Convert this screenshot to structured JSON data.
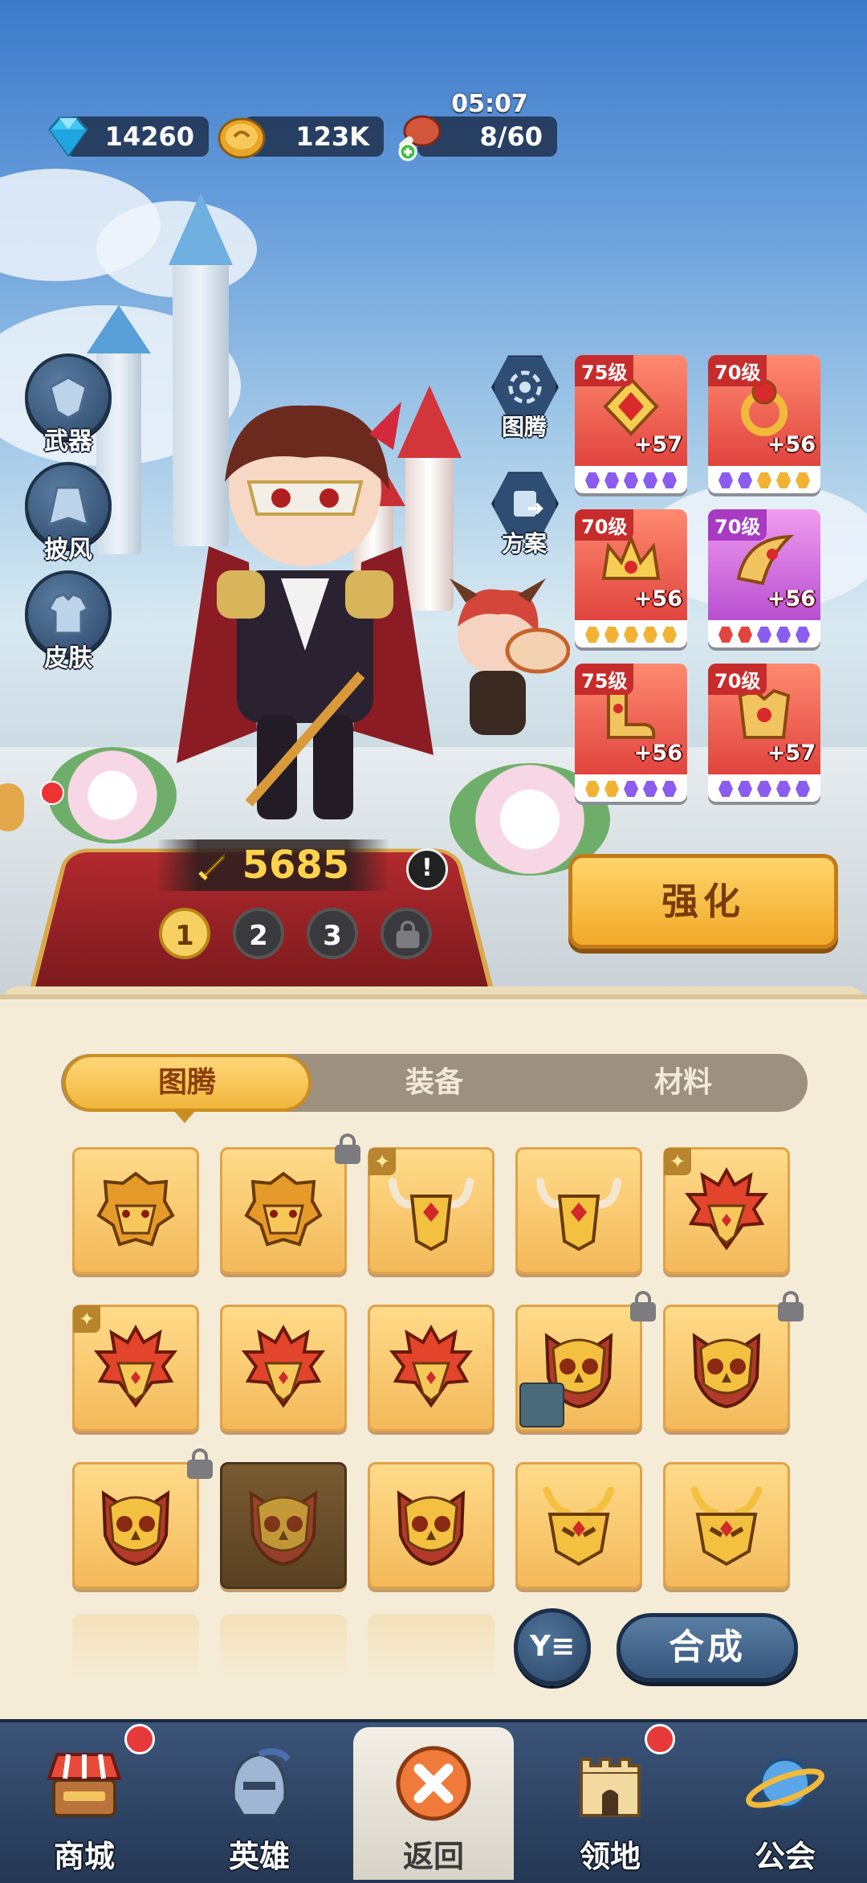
{
  "currency": {
    "timer": "05:07",
    "gems": "14260",
    "gold": "123K",
    "stamina": "8/60"
  },
  "side_menu": [
    {
      "label": "武器",
      "icon": "weapon-icon"
    },
    {
      "label": "披风",
      "icon": "cape-icon"
    },
    {
      "label": "皮肤",
      "icon": "skin-icon"
    }
  ],
  "hex_menu": [
    {
      "label": "图腾",
      "icon": "totem-icon"
    },
    {
      "label": "方案",
      "icon": "preset-icon"
    }
  ],
  "equipment": [
    {
      "level": "75级",
      "plus": "+57",
      "rarity": "red",
      "dots": [
        "#8a5cf0",
        "#8a5cf0",
        "#8a5cf0",
        "#8a5cf0",
        "#8a5cf0"
      ]
    },
    {
      "level": "70级",
      "plus": "+56",
      "rarity": "red",
      "dots": [
        "#8a5cf0",
        "#8a5cf0",
        "#f2b233",
        "#f2b233",
        "#f2b233"
      ]
    },
    {
      "level": "70级",
      "plus": "+56",
      "rarity": "red",
      "dots": [
        "#f2b233",
        "#f2b233",
        "#f2b233",
        "#f2b233",
        "#f2b233"
      ]
    },
    {
      "level": "70级",
      "plus": "+56",
      "rarity": "purple",
      "dots": [
        "#e2443e",
        "#e2443e",
        "#8a5cf0",
        "#8a5cf0",
        "#8a5cf0"
      ]
    },
    {
      "level": "75级",
      "plus": "+56",
      "rarity": "red",
      "dots": [
        "#f2b233",
        "#f2b233",
        "#8a5cf0",
        "#8a5cf0",
        "#8a5cf0"
      ]
    },
    {
      "level": "70级",
      "plus": "+57",
      "rarity": "red",
      "dots": [
        "#8a5cf0",
        "#8a5cf0",
        "#8a5cf0",
        "#8a5cf0",
        "#8a5cf0"
      ]
    }
  ],
  "power": "5685",
  "warning": "!",
  "loadout_slots": [
    "1",
    "2",
    "3"
  ],
  "enhance_label": "强化",
  "tabs": [
    "图腾",
    "装备",
    "材料"
  ],
  "totem_grid": [
    [
      {
        "type": "lion",
        "lock": false,
        "star": false
      },
      {
        "type": "lion",
        "lock": true,
        "star": false
      },
      {
        "type": "bull",
        "lock": false,
        "star": true
      },
      {
        "type": "bull",
        "lock": false,
        "star": false
      },
      {
        "type": "phoenix",
        "lock": false,
        "star": true
      }
    ],
    [
      {
        "type": "phoenix",
        "lock": false,
        "star": true
      },
      {
        "type": "phoenix",
        "lock": false,
        "star": false
      },
      {
        "type": "phoenix",
        "lock": false,
        "star": false
      },
      {
        "type": "owl",
        "lock": true,
        "star": false,
        "hero": true
      },
      {
        "type": "owl",
        "lock": true,
        "star": false
      }
    ],
    [
      {
        "type": "owl",
        "lock": true,
        "star": false
      },
      {
        "type": "owl",
        "lock": false,
        "star": false,
        "selected": true
      },
      {
        "type": "owl",
        "lock": false,
        "star": false
      },
      {
        "type": "beetle",
        "lock": false,
        "star": false
      },
      {
        "type": "beetle",
        "lock": false,
        "star": false
      }
    ]
  ],
  "filter_label": "Y≡",
  "compose_label": "合成",
  "nav": [
    {
      "label": "商城",
      "icon": "shop-icon",
      "badge": true
    },
    {
      "label": "英雄",
      "icon": "helmet-icon",
      "badge": false
    },
    {
      "label": "返回",
      "icon": "close-icon",
      "badge": false,
      "active": true
    },
    {
      "label": "领地",
      "icon": "castle-icon",
      "badge": true
    },
    {
      "label": "公会",
      "icon": "planet-icon",
      "badge": false
    }
  ]
}
